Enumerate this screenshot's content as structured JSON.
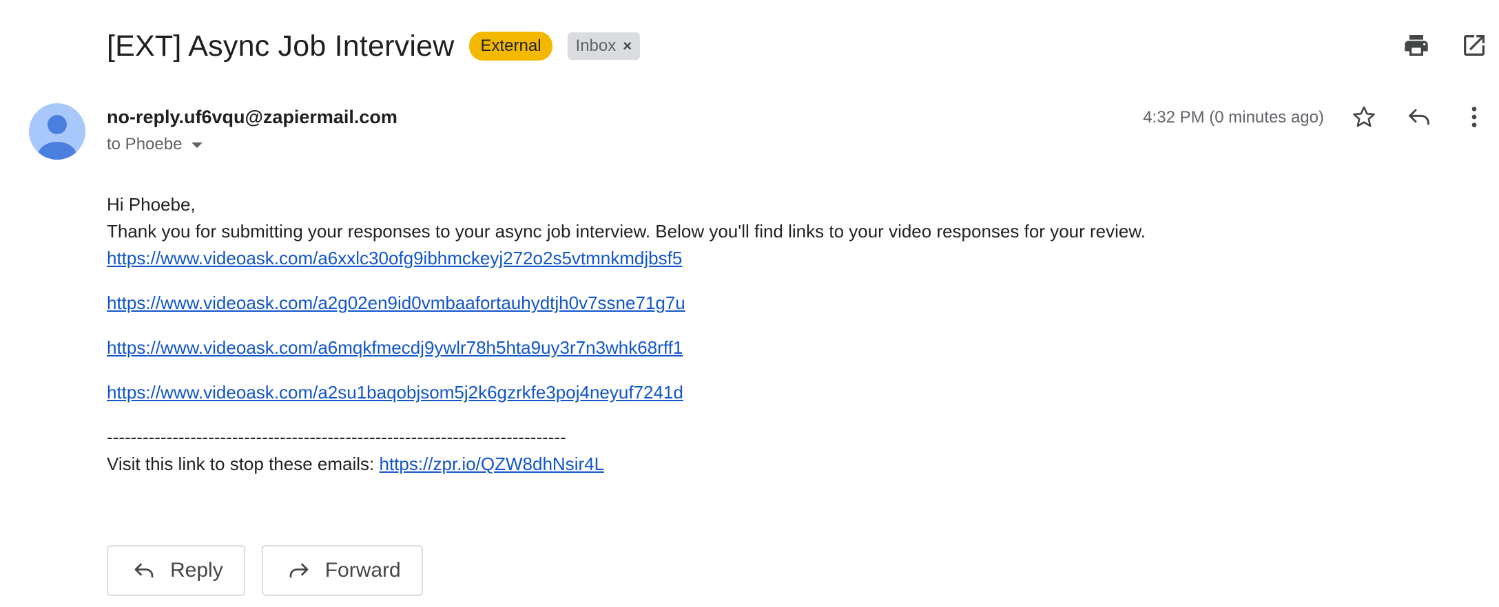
{
  "subject": "[EXT] Async Job Interview",
  "labels": {
    "external": "External",
    "inbox": "Inbox",
    "inbox_remove": "×"
  },
  "toolbar": {
    "print_icon": "print-icon",
    "open_new_window_icon": "open-in-new-icon"
  },
  "sender": {
    "email": "no-reply.uf6vqu@zapiermail.com",
    "to": "to Phoebe",
    "time": "4:32 PM (0 minutes ago)"
  },
  "message": {
    "greeting": "Hi Phoebe,",
    "intro": "Thank you for submitting your responses to your async job interview. Below you'll find links to your video responses for your review.",
    "links": [
      "https://www.videoask.com/a6xxlc30ofg9ibhmckeyj272o2s5vtmnkmdjbsf5",
      "https://www.videoask.com/a2g02en9id0vmbaafortauhydtjh0v7ssne71g7u",
      "https://www.videoask.com/a6mqkfmecdj9ywlr78h5hta9uy3r7n3whk68rff1",
      "https://www.videoask.com/a2su1baqobjsom5j2k6gzrkfe3poj4neyuf7241d"
    ],
    "divider": "-----------------------------------------------------------------------------",
    "unsubscribe_text": "Visit this link to stop these emails: ",
    "unsubscribe_link": "https://zpr.io/QZW8dhNsir4L"
  },
  "actions": {
    "reply": "Reply",
    "forward": "Forward"
  },
  "colors": {
    "external_label": "#f5b800",
    "link": "#1155cc",
    "avatar_bg": "#a8c7fa",
    "avatar_fg": "#4285f4"
  }
}
